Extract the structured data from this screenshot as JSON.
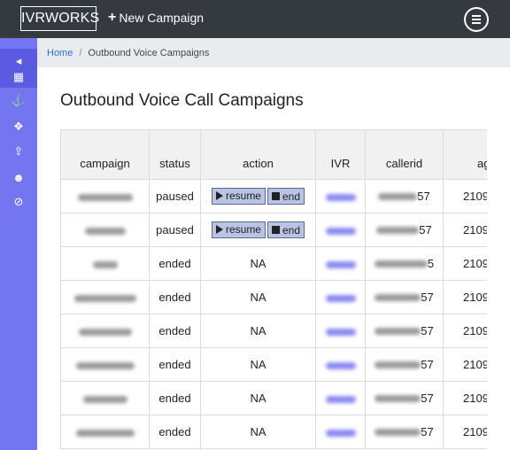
{
  "topbar": {
    "brand": "IVRWORKS",
    "new_campaign_label": "New Campaign",
    "new_campaign_icon": "plus-icon",
    "menu_icon": "hamburger-menu-icon"
  },
  "sidebar": {
    "items": [
      {
        "icon": "collapse-caret-icon",
        "glyph": "◂"
      },
      {
        "icon": "table-icon",
        "glyph": "▦"
      },
      {
        "icon": "anchor-icon",
        "glyph": "⚓"
      },
      {
        "icon": "cubes-icon",
        "glyph": "❖"
      },
      {
        "icon": "upload-icon",
        "glyph": "⇪"
      },
      {
        "icon": "users-icon",
        "glyph": "☻"
      },
      {
        "icon": "ban-icon",
        "glyph": "⊘"
      }
    ]
  },
  "breadcrumb": {
    "home": "Home",
    "separator": "/",
    "current": "Outbound Voice Campaigns"
  },
  "page_title": "Outbound Voice Call Campaigns",
  "table": {
    "headers": [
      "campaign",
      "status",
      "action",
      "IVR",
      "callerid",
      "ag"
    ],
    "rows": [
      {
        "status": "paused",
        "actions": [
          "resume",
          "end"
        ],
        "callerid_tail": "57",
        "ag": "2109"
      },
      {
        "status": "paused",
        "actions": [
          "resume",
          "end"
        ],
        "callerid_tail": "57",
        "ag": "2109"
      },
      {
        "status": "ended",
        "action_text": "NA",
        "callerid_tail": "5",
        "ag": "2109"
      },
      {
        "status": "ended",
        "action_text": "NA",
        "callerid_tail": "57",
        "ag": "2109"
      },
      {
        "status": "ended",
        "action_text": "NA",
        "callerid_tail": "57",
        "ag": "2109"
      },
      {
        "status": "ended",
        "action_text": "NA",
        "callerid_tail": "57",
        "ag": "2109"
      },
      {
        "status": "ended",
        "action_text": "NA",
        "callerid_tail": "57",
        "ag": "2109"
      },
      {
        "status": "ended",
        "action_text": "NA",
        "callerid_tail": "57",
        "ag": "2109"
      }
    ]
  },
  "colors": {
    "topbar": "#343a40",
    "sidebar": "#7475f0",
    "sidebar_active": "#5a5be2",
    "breadcrumb_bg": "#e9ecef",
    "link": "#2f6fd6",
    "button_bg": "#b9c3e3"
  }
}
